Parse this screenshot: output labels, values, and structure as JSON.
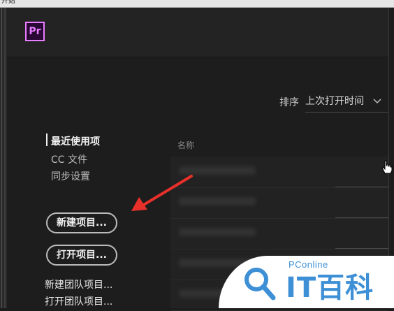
{
  "window": {
    "title": "开始"
  },
  "header": {
    "logo_text": "Pr"
  },
  "sort": {
    "label": "排序",
    "selected": "上次打开时间"
  },
  "nav": {
    "items": [
      {
        "label": "最近使用项",
        "active": true
      },
      {
        "label": "CC 文件",
        "active": false
      },
      {
        "label": "同步设置",
        "active": false
      }
    ]
  },
  "actions": {
    "new_project": "新建项目...",
    "open_project": "打开项目...",
    "new_team_project": "新建团队项目...",
    "open_team_project": "打开团队项目..."
  },
  "list": {
    "column_name": "名称"
  },
  "watermark": {
    "top_text": "PConline",
    "brand_text": "IT百科"
  },
  "colors": {
    "background": "#1d1d1d",
    "premiere_purple": "#e77dff",
    "annotation_red": "#e8302a",
    "watermark_blue": "#3d8fd6"
  }
}
